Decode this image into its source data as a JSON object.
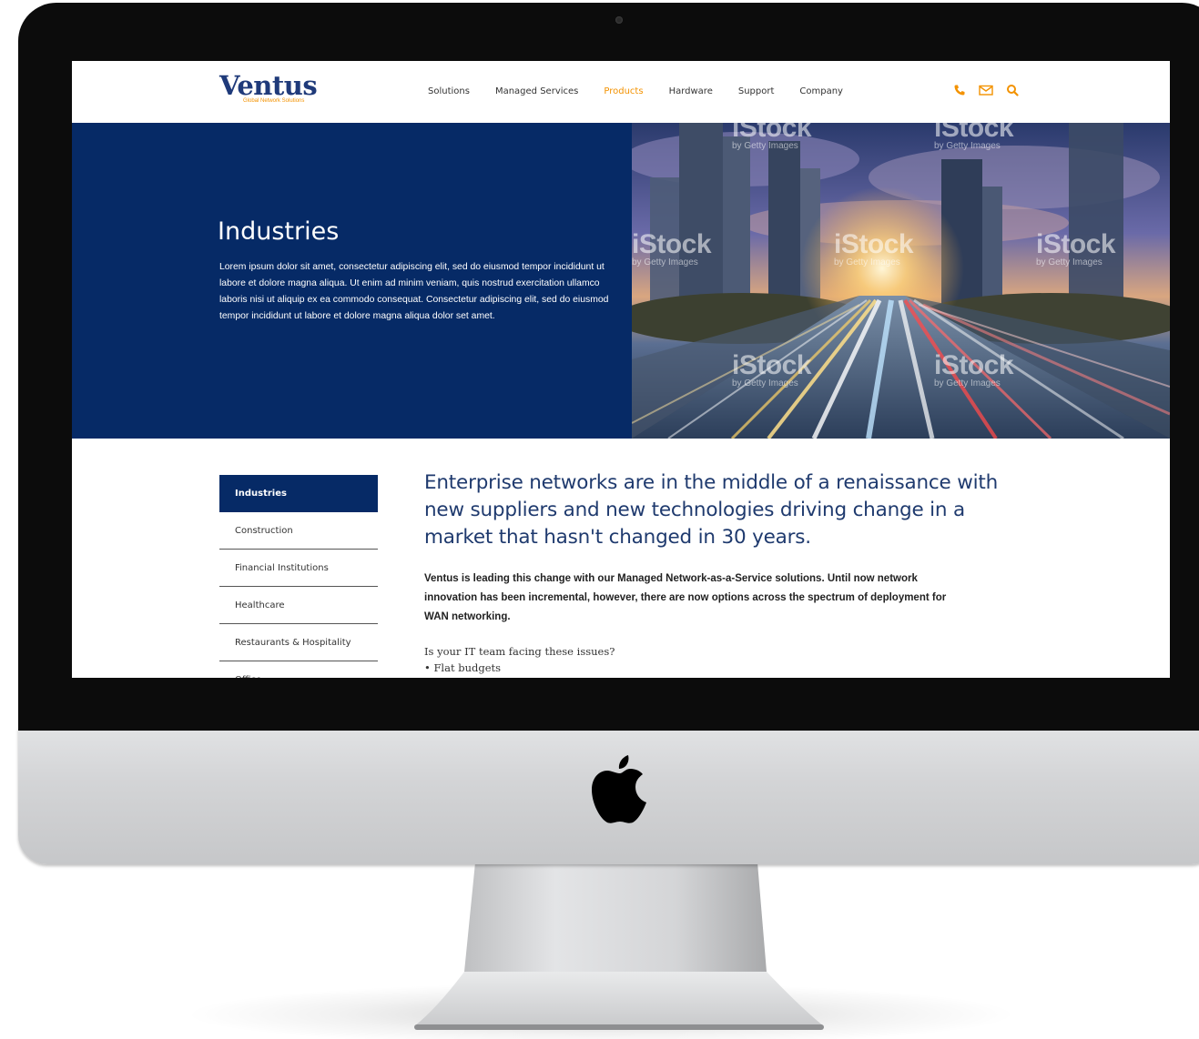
{
  "logo": {
    "name": "Ventus",
    "tagline": "Global Network Solutions"
  },
  "nav": {
    "items": [
      {
        "label": "Solutions",
        "active": false
      },
      {
        "label": "Managed Services",
        "active": false
      },
      {
        "label": "Products",
        "active": true
      },
      {
        "label": "Hardware",
        "active": false
      },
      {
        "label": "Support",
        "active": false
      },
      {
        "label": "Company",
        "active": false
      }
    ]
  },
  "header_icons": [
    "phone-icon",
    "mail-icon",
    "search-icon"
  ],
  "hero": {
    "title": "Industries",
    "text": "Lorem ipsum dolor sit amet, consectetur adipiscing elit, sed do eiusmod tempor incididunt ut labore et dolore magna aliqua. Ut enim ad minim veniam, quis nostrud exercitation ullamco laboris nisi ut aliquip ex ea commodo consequat. Consectetur adipiscing elit, sed do eiusmod tempor incididunt ut labore et dolore magna aliqua dolor set amet.",
    "watermark_brand": "iStock",
    "watermark_sub": "by Getty Images"
  },
  "sidebar": {
    "items": [
      {
        "label": "Industries",
        "active": true
      },
      {
        "label": "Construction",
        "active": false
      },
      {
        "label": "Financial Institutions",
        "active": false
      },
      {
        "label": "Healthcare",
        "active": false
      },
      {
        "label": "Restaurants & Hospitality",
        "active": false
      },
      {
        "label": "Office",
        "active": false
      }
    ]
  },
  "main": {
    "headline": "Enterprise networks are in the middle of a renaissance with new suppliers and new technologies driving change in a market that hasn't changed in 30 years.",
    "lead": "Ventus is leading this change with our Managed Network-as-a-Service solutions. Until now network innovation has been incremental, however, there are now options across the spectrum of deployment for WAN networking.",
    "question": "Is your IT team facing these issues?",
    "bullets": [
      "• Flat budgets"
    ]
  },
  "colors": {
    "brand_navy": "#062a66",
    "accent_orange": "#f39200",
    "headline_blue": "#1f3a6e"
  }
}
